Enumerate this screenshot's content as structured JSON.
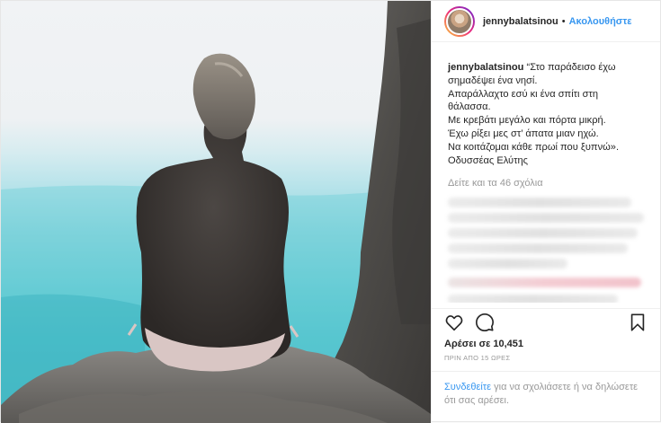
{
  "header": {
    "username": "jennybalatsinou",
    "separator": "•",
    "follow_label": "Ακολουθήστε"
  },
  "caption": {
    "username": "jennybalatsinou",
    "lines": [
      "“Στο παράδεισο έχω",
      "σημαδέψει ένα νησί.",
      "Απαράλλαχτο εσύ κι ένα σπίτι στη",
      "θάλασσα.",
      "Με κρεβάτι μεγάλο και πόρτα μικρή.",
      "Έχω ρίξει μες στ’ άπατα μιαν ηχώ.",
      "Να κοιτάζομαι κάθε πρωί που ξυπνώ».",
      "Οδυσσέας Ελύτης"
    ]
  },
  "view_all": "Δείτε και τα 46 σχόλια",
  "likes": "Αρέσει σε 10,451",
  "timestamp": "ΠΡΙΝ ΑΠΟ 15 ΩΡΕΣ",
  "login": {
    "link": "Συνδεθείτε",
    "rest": " για να σχολιάσετε ή να δηλώσετε ότι σας αρέσει."
  },
  "icons": {
    "like": "heart-icon",
    "comment": "comment-icon",
    "save": "bookmark-icon"
  }
}
